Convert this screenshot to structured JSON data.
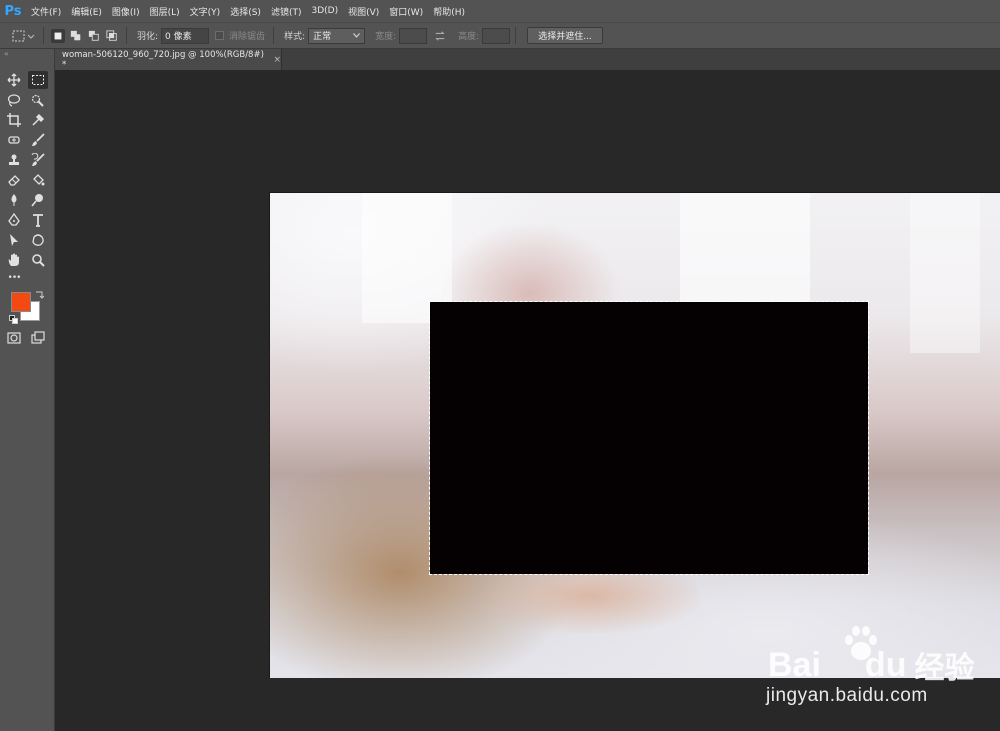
{
  "app": {
    "logo": "Ps"
  },
  "menu": [
    "文件(F)",
    "编辑(E)",
    "图像(I)",
    "图层(L)",
    "文字(Y)",
    "选择(S)",
    "滤镜(T)",
    "3D(D)",
    "视图(V)",
    "窗口(W)",
    "帮助(H)"
  ],
  "options": {
    "feather_label": "羽化:",
    "feather_value": "0 像素",
    "antialias_label": "消除锯齿",
    "style_label": "样式:",
    "style_value": "正常",
    "width_label": "宽度:",
    "height_label": "高度:",
    "select_mask_button": "选择并遮住..."
  },
  "document": {
    "tab_title": "woman-506120_960_720.jpg @ 100%(RGB/8#) *",
    "close_glyph": "×"
  },
  "colors": {
    "foreground": "#f24a12",
    "background": "#ffffff",
    "accent": "#31a8ff",
    "fill_rect": "#050002"
  },
  "toolbar": {
    "collapse_glyph": "‹‹",
    "more_glyph": "•••",
    "tools": [
      "move-tool",
      "rectangular-marquee-tool",
      "lasso-tool",
      "quick-selection-tool",
      "crop-tool",
      "eyedropper-tool",
      "spot-healing-tool",
      "brush-tool",
      "clone-stamp-tool",
      "history-brush-tool",
      "eraser-tool",
      "paint-bucket-tool",
      "blur-tool",
      "dodge-tool",
      "pen-tool",
      "type-tool",
      "path-selection-tool",
      "custom-shape-tool",
      "hand-tool",
      "zoom-tool"
    ]
  },
  "watermark": {
    "brand_latin": "Bai",
    "brand_du": "du",
    "brand_cn": "经验",
    "url": "jingyan.baidu.com"
  }
}
